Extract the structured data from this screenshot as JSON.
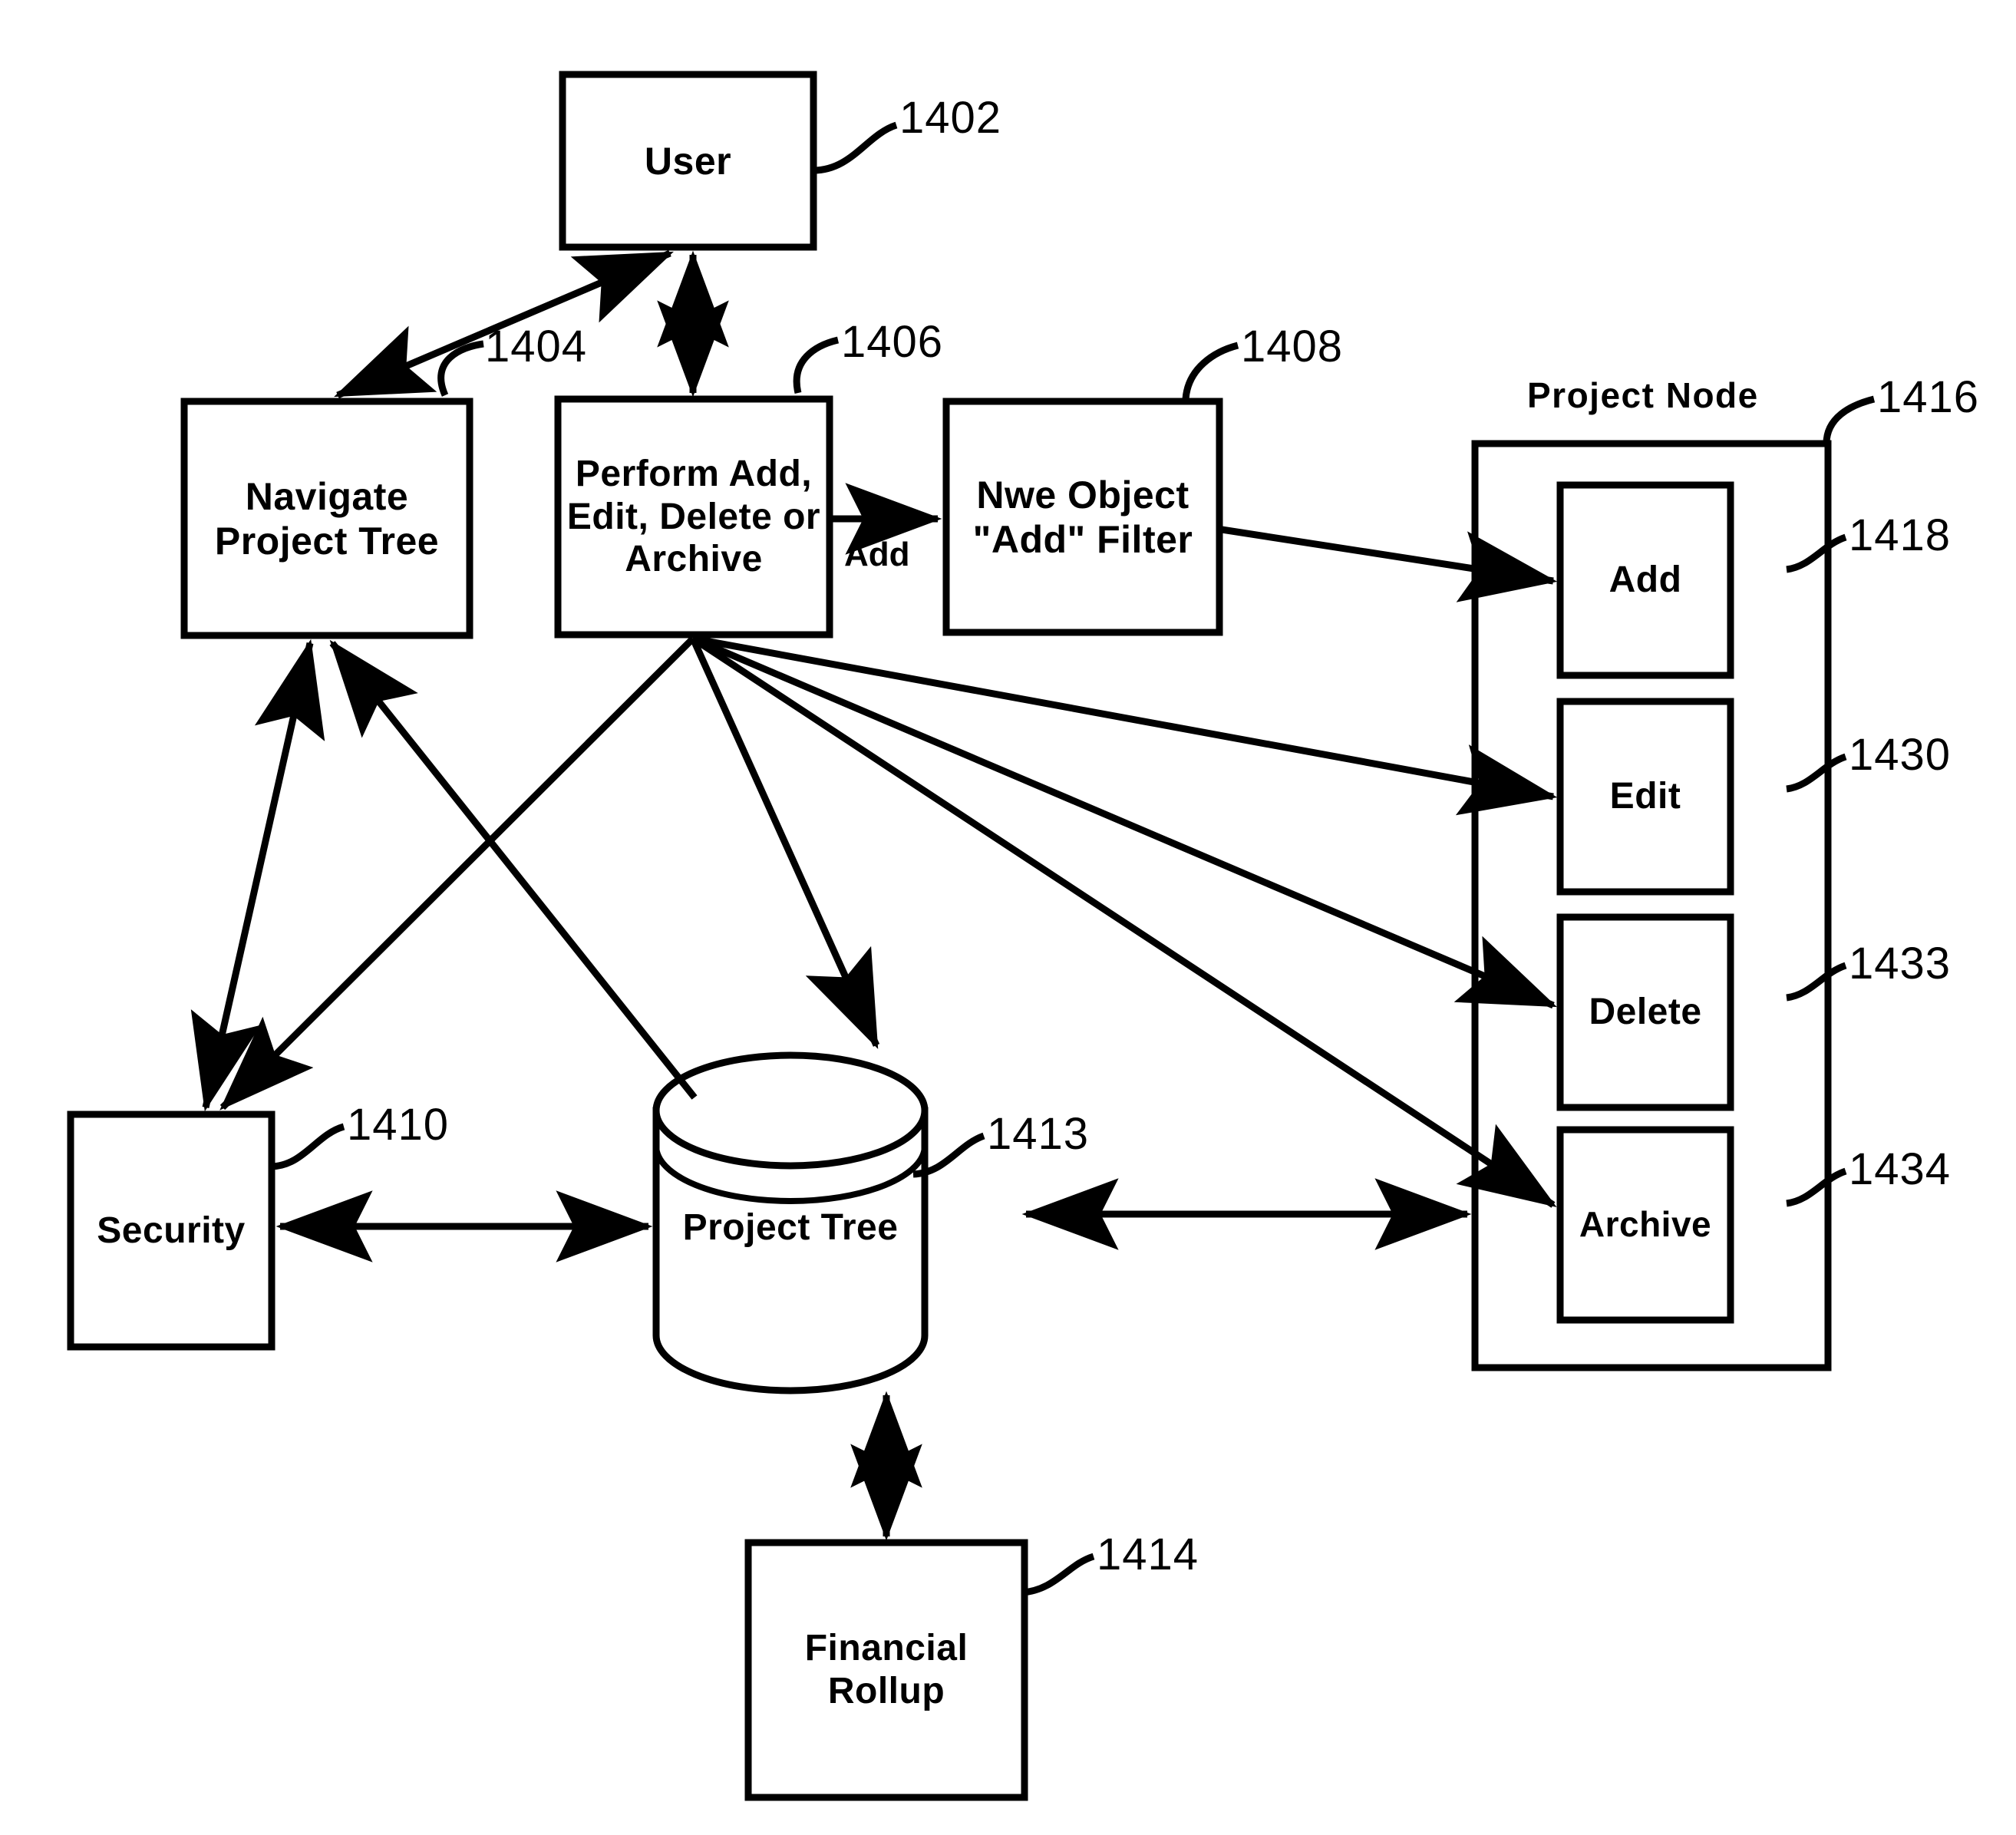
{
  "figure": {
    "kind": "patent-block-diagram",
    "background": "#ffffff",
    "stroke": "#000000"
  },
  "nodes": {
    "user": {
      "label": "User",
      "ref": "1402"
    },
    "navigate": {
      "label": "Navigate\nProject Tree",
      "ref": "1404"
    },
    "perform": {
      "label": "Perform Add,\nEdit, Delete or\nArchive",
      "ref": "1406"
    },
    "filter": {
      "label": "Nwe Object\n\"Add\" Filter",
      "ref": "1408"
    },
    "security": {
      "label": "Security",
      "ref": "1410"
    },
    "project_tree": {
      "label": "Project Tree",
      "ref": "1413"
    },
    "financial_rollup": {
      "label": "Financial\nRollup",
      "ref": "1414"
    },
    "project_node": {
      "title": "Project Node",
      "ref": "1416"
    },
    "add": {
      "label": "Add",
      "ref": "1418"
    },
    "edit": {
      "label": "Edit",
      "ref": "1430"
    },
    "delete": {
      "label": "Delete",
      "ref": "1433"
    },
    "archive": {
      "label": "Archive",
      "ref": "1434"
    }
  },
  "edge_labels": {
    "perform_to_filter": "Add"
  },
  "reference_numerals": [
    "1402",
    "1404",
    "1406",
    "1408",
    "1410",
    "1413",
    "1414",
    "1416",
    "1418",
    "1430",
    "1433",
    "1434"
  ],
  "node_labels_flat": [
    "User",
    "Navigate Project Tree",
    "Perform Add, Edit, Delete or Archive",
    "Nwe Object \"Add\" Filter",
    "Security",
    "Project Tree",
    "Financial Rollup",
    "Project Node",
    "Add",
    "Edit",
    "Delete",
    "Archive"
  ]
}
